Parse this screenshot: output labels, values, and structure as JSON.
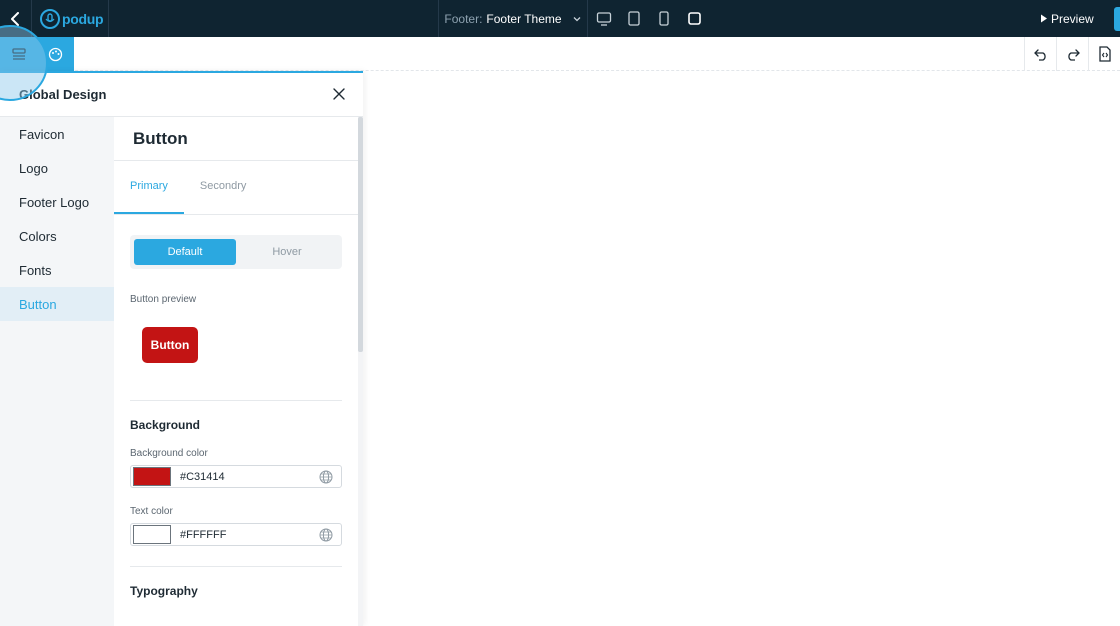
{
  "topbar": {
    "logo_text": "podup",
    "theme_label": "Footer:",
    "theme_value": "Footer Theme",
    "preview_label": "Preview"
  },
  "panel": {
    "title": "Global Design",
    "nav": [
      {
        "label": "Favicon"
      },
      {
        "label": "Logo"
      },
      {
        "label": "Footer Logo"
      },
      {
        "label": "Colors"
      },
      {
        "label": "Fonts"
      },
      {
        "label": "Button"
      }
    ],
    "active_nav": "Button"
  },
  "button_section": {
    "title": "Button",
    "tabs": [
      "Primary",
      "Secondry"
    ],
    "active_tab": "Primary",
    "states": [
      "Default",
      "Hover"
    ],
    "active_state": "Default",
    "preview_label": "Button preview",
    "preview_button_text": "Button",
    "background_heading": "Background",
    "background_color_label": "Background color",
    "background_color_value": "#C31414",
    "text_color_label": "Text color",
    "text_color_value": "#FFFFFF",
    "typography_heading": "Typography"
  },
  "colors": {
    "accent": "#2ba8e0",
    "topbar_bg": "#0f2431",
    "button_bg": "#C31414",
    "button_text": "#FFFFFF"
  }
}
